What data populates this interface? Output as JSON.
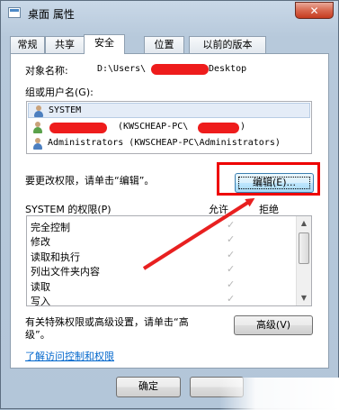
{
  "window": {
    "title": "桌面 属性",
    "close_glyph": "✕"
  },
  "tabs": [
    {
      "label": "常规"
    },
    {
      "label": "共享"
    },
    {
      "label": "安全"
    },
    {
      "label": "位置"
    },
    {
      "label": "以前的版本"
    }
  ],
  "security": {
    "object_label": "对象名称:",
    "object_path_prefix": "D:\\Users\\",
    "object_path_suffix": "Desktop",
    "groups_label": "组或用户名(G):",
    "groups": [
      {
        "name": "SYSTEM",
        "icon": "system-group-icon"
      },
      {
        "name": "(KWSCHEAP-PC\\",
        "suffix": ")",
        "icon": "user-icon"
      },
      {
        "name": "Administrators (KWSCHEAP-PC\\Administrators)",
        "icon": "admin-group-icon"
      }
    ],
    "change_hint": "要更改权限，请单击“编辑”。",
    "edit_button": "编辑(E)...",
    "perm_title": "SYSTEM 的权限(P)",
    "col_allow": "允许",
    "col_deny": "拒绝",
    "permissions": [
      {
        "name": "完全控制",
        "allow": true
      },
      {
        "name": "修改",
        "allow": true
      },
      {
        "name": "读取和执行",
        "allow": true
      },
      {
        "name": "列出文件夹内容",
        "allow": true
      },
      {
        "name": "读取",
        "allow": true
      },
      {
        "name": "写入",
        "allow": true
      }
    ],
    "check_glyph": "✓",
    "special_hint_line1": "有关特殊权限或高级设置，请单击“高",
    "special_hint_line2": "级”。",
    "advanced_button": "高级(V)",
    "learn_link": "了解访问控制和权限"
  },
  "footer": {
    "ok_button": "确定"
  },
  "colors": {
    "highlight": "#ee0000",
    "arrow": "#e82020",
    "redaction": "#ee1c1c"
  }
}
